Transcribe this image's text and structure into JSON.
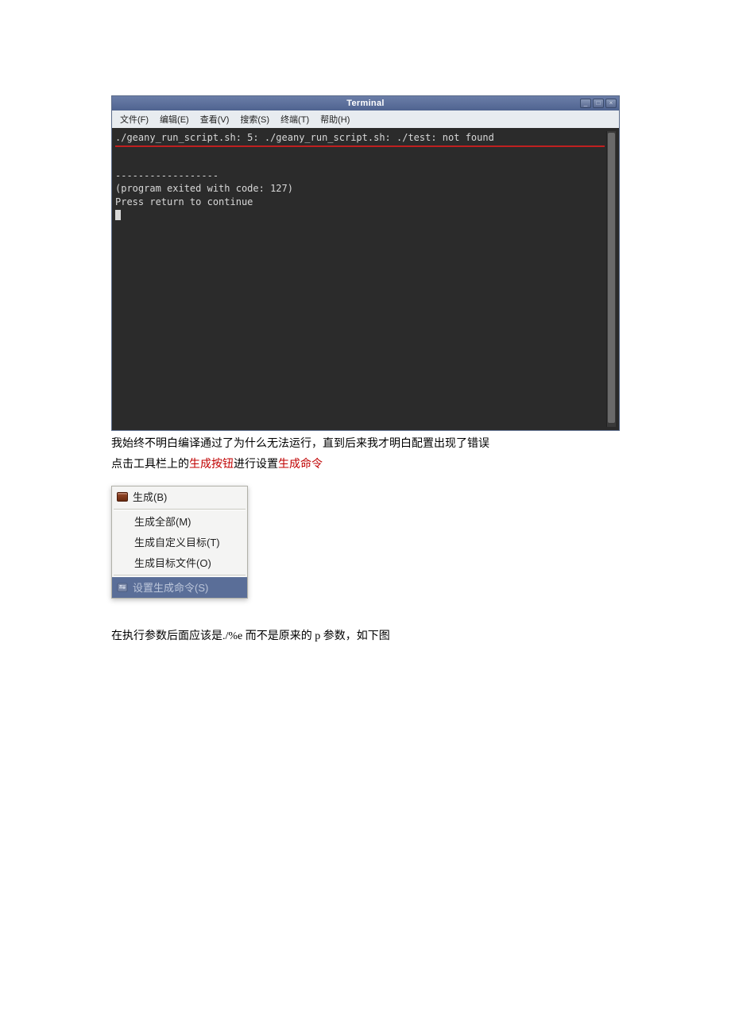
{
  "terminal": {
    "title": "Terminal",
    "menus": [
      "文件(F)",
      "编辑(E)",
      "查看(V)",
      "搜索(S)",
      "终端(T)",
      "帮助(H)"
    ],
    "line_error": "./geany_run_script.sh: 5: ./geany_run_script.sh: ./test: not found",
    "dashes": "------------------",
    "exit_line": "(program exited with code: 127)",
    "press_line": "Press return to continue"
  },
  "paragraph1": {
    "pre": "我始终不明白编译通过了为什么无法运行，直到后来我才明白配置出现了错误"
  },
  "paragraph2": {
    "a": "点击工具栏上的",
    "b": "生成按钮",
    "c": "进行设置",
    "d": "生成命令"
  },
  "build_menu": {
    "build": "生成(B)",
    "make_all": "生成全部(M)",
    "make_custom": "生成自定义目标(T)",
    "make_object": "生成目标文件(O)",
    "set_build_cmds": "设置生成命令(S)"
  },
  "paragraph3": {
    "text": "在执行参数后面应该是./%e 而不是原来的 p 参数，如下图"
  }
}
